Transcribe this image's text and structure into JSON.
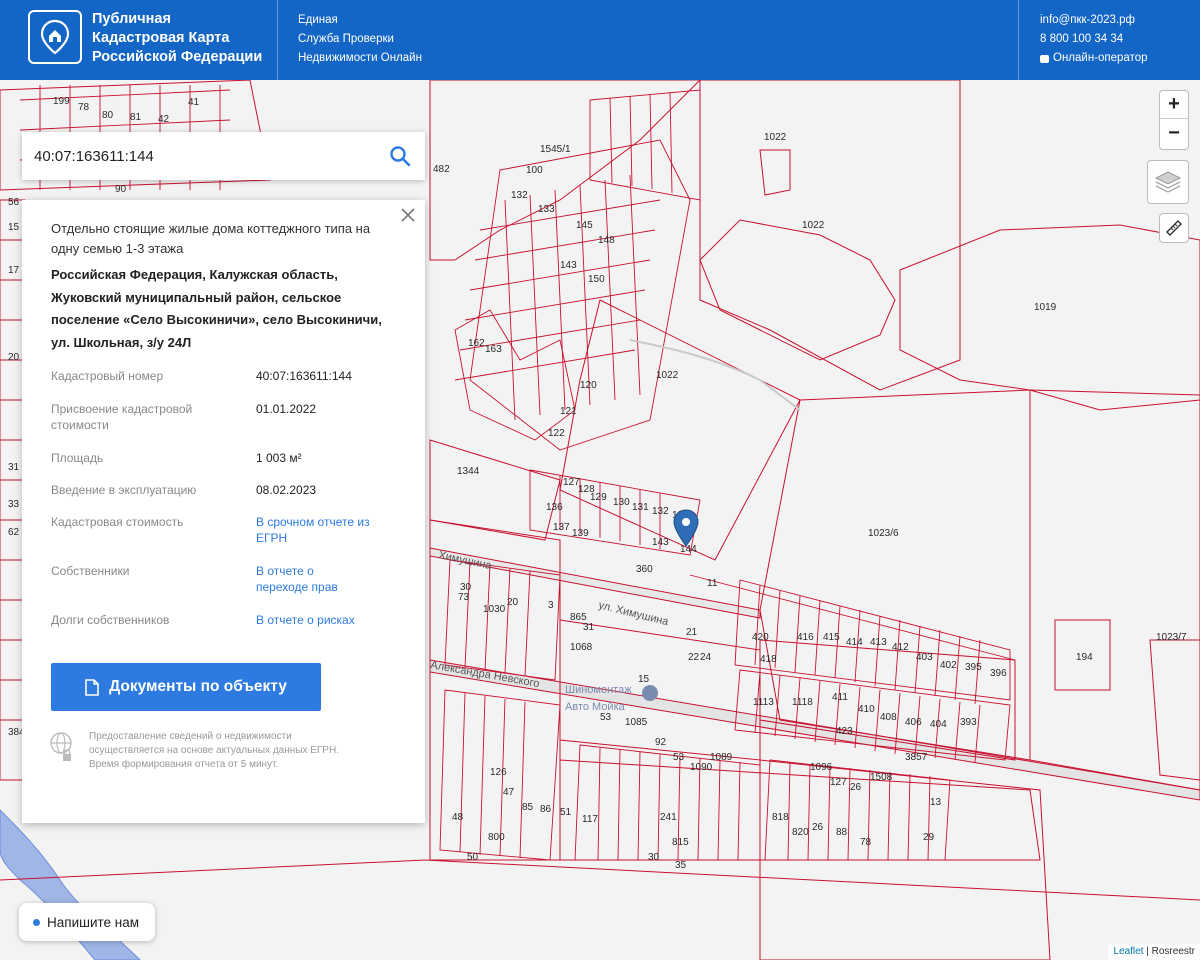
{
  "header": {
    "brand_line1": "Публичная",
    "brand_line2": "Кадастровая Карта",
    "brand_line3": "Российской Федерации",
    "service_line1": "Единая",
    "service_line2": "Служба Проверки",
    "service_line3": "Недвижимости Онлайн",
    "email": "info@пкк-2023.рф",
    "phone": "8 800 100 34 34",
    "operator": "Онлайн-оператор"
  },
  "search": {
    "value": "40:07:163611:144",
    "icon": "search-icon"
  },
  "panel": {
    "type": "Отдельно стоящие жилые дома коттеджного типа на одну семью 1-3 этажа",
    "address": "Российская Федерация, Калужская область, Жуковский муниципальный район, сельское поселение «Село Высокиничи», село Высокиничи, ул. Школьная, з/у 24Л",
    "rows": [
      {
        "label": "Кадастровый номер",
        "value": "40:07:163611:144"
      },
      {
        "label": "Присвоение кадастровой стоимости",
        "value": "01.01.2022"
      },
      {
        "label": "Площадь",
        "value": "1 003 м²"
      },
      {
        "label": "Введение в эксплуатацию",
        "value": "08.02.2023"
      },
      {
        "label": "Кадастровая стоимость",
        "value": "В срочном отчете из ЕГРН"
      },
      {
        "label": "Собственники",
        "value": "В отчете о переходе прав"
      },
      {
        "label": "Долги собственников",
        "value": "В отчете о рисках"
      }
    ],
    "doc_button": "Документы по объекту",
    "notice": "Предоставление сведений о недвижимости осуществляется на основе актуальных данных ЕГРН. Время формирования отчета от 5 минут."
  },
  "map": {
    "labels": [
      "1022",
      "1019",
      "1344",
      "1023/6",
      "1023/7",
      "194",
      "3857",
      "482",
      "1545/1",
      "144",
      "360",
      "420",
      "418"
    ],
    "streets": [
      "Химушина",
      "ул. Химушина",
      "Александра Невского"
    ],
    "poi": [
      "Шиномонтаж",
      "Авто Мойка"
    ],
    "accent_color": "#c8102e"
  },
  "controls": {
    "zoom_in": "+",
    "zoom_out": "−"
  },
  "chat": {
    "label": "Напишите нам"
  },
  "attribution": {
    "leaflet": "Leaflet",
    "source": "Rosreestr"
  }
}
